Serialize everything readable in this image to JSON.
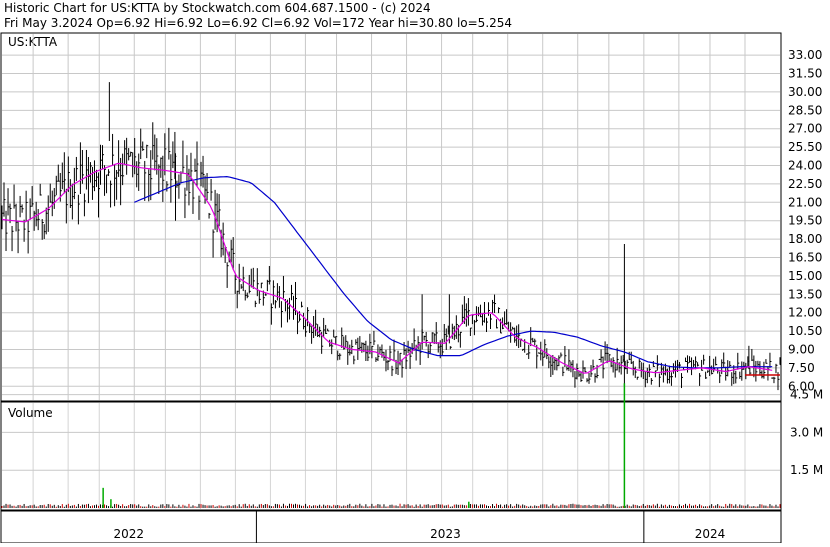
{
  "header": {
    "line1": "Historic Chart for US:KTTA by Stockwatch.com 604.687.1500 - (c) 2024",
    "line2": "Fri May  3.2024   Op=6.92  Hi=6.92  Lo=6.92  Cl=6.92  Vol=172   Year hi=30.80   lo=5.254"
  },
  "symbol_label": "US:KTTA",
  "volume_label": "Volume",
  "chart_data": [
    {
      "type": "ohlc",
      "title": "US:KTTA",
      "y_ticks": [
        "33.00",
        "31.50",
        "30.00",
        "28.50",
        "27.00",
        "25.50",
        "24.00",
        "22.50",
        "21.00",
        "19.50",
        "18.00",
        "16.50",
        "15.00",
        "13.50",
        "12.00",
        "10.50",
        "9.00",
        "7.50",
        "6.00"
      ],
      "ylim": [
        5.0,
        34.0
      ],
      "x_ticks": [
        "2022",
        "2023",
        "2024"
      ],
      "grid": true,
      "colors": {
        "price": "#000000",
        "ma_short": "#e000e0",
        "ma_long": "#0000cc",
        "last": "#cc0000"
      },
      "ma_short": {
        "x": [
          0,
          0.03,
          0.06,
          0.09,
          0.12,
          0.15,
          0.18,
          0.21,
          0.24,
          0.27,
          0.3,
          0.33,
          0.36,
          0.39,
          0.42,
          0.45,
          0.48,
          0.51,
          0.54,
          0.57,
          0.6,
          0.63,
          0.66,
          0.69,
          0.72,
          0.75,
          0.78,
          0.81,
          0.84,
          0.87,
          0.9,
          0.93,
          0.96,
          0.99
        ],
        "y": [
          19.6,
          19.4,
          20.5,
          22.4,
          23.5,
          24.2,
          23.8,
          23.6,
          23.3,
          20.5,
          15.0,
          13.8,
          13.2,
          11.5,
          9.6,
          9.0,
          8.8,
          7.9,
          9.6,
          9.5,
          11.8,
          12.0,
          10.0,
          9.1,
          7.9,
          7.0,
          8.1,
          7.4,
          7.1,
          7.3,
          7.5,
          7.2,
          7.6,
          7.3
        ]
      },
      "ma_long": {
        "x": [
          0.17,
          0.2,
          0.23,
          0.26,
          0.29,
          0.32,
          0.35,
          0.38,
          0.41,
          0.44,
          0.47,
          0.5,
          0.53,
          0.56,
          0.59,
          0.62,
          0.65,
          0.68,
          0.71,
          0.74,
          0.77,
          0.8,
          0.83,
          0.86,
          0.89,
          0.92,
          0.95,
          0.99
        ],
        "y": [
          21.0,
          21.8,
          22.6,
          23.0,
          23.1,
          22.6,
          21.0,
          18.5,
          16.0,
          13.5,
          11.3,
          9.8,
          9.0,
          8.5,
          8.5,
          9.4,
          10.1,
          10.5,
          10.4,
          10.0,
          9.3,
          8.8,
          8.0,
          7.6,
          7.5,
          7.5,
          7.6,
          7.6
        ]
      },
      "last_price": 6.92
    },
    {
      "type": "bar",
      "title": "Volume",
      "y_ticks": [
        "4.5 M",
        "3.0 M",
        "1.5 M"
      ],
      "ylim": [
        0,
        5.0
      ],
      "spikes": [
        {
          "x": 0.13,
          "value": 0.8
        },
        {
          "x": 0.14,
          "value": 0.35
        },
        {
          "x": 0.6,
          "value": 0.25
        },
        {
          "x": 0.8,
          "value": 4.95
        }
      ]
    }
  ]
}
